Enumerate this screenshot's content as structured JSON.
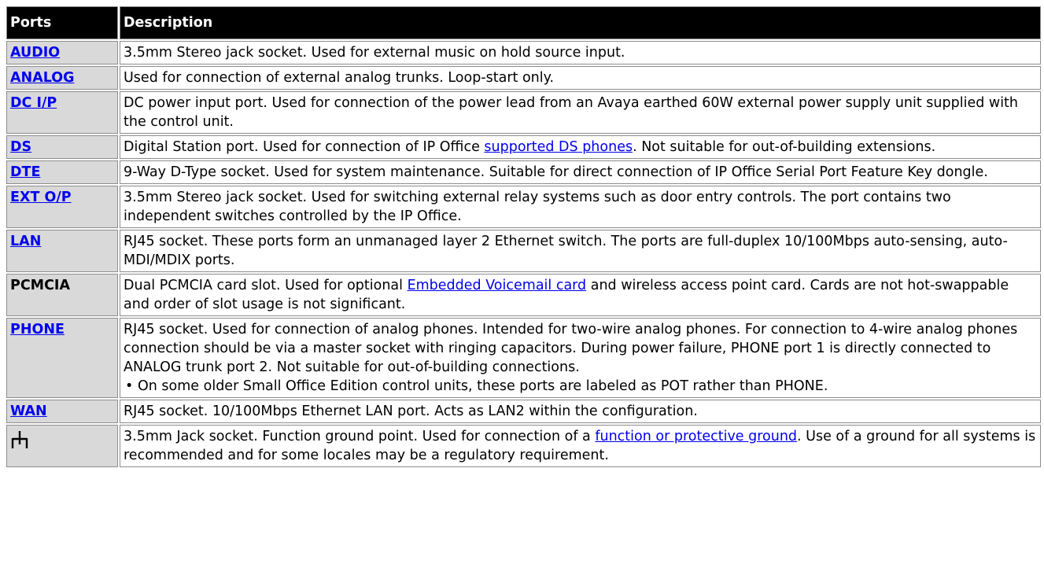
{
  "table": {
    "headers": {
      "ports": "Ports",
      "description": "Description"
    },
    "rows": [
      {
        "port": "AUDIO",
        "segments": [
          "3.5mm Stereo jack socket. Used for external music on hold source input."
        ]
      },
      {
        "port": "ANALOG",
        "segments": [
          "Used for connection of external analog trunks. Loop-start only."
        ]
      },
      {
        "port": "DC I/P",
        "segments": [
          "DC power input port. Used for connection of the power lead from an Avaya earthed 60W external power supply unit supplied with the control unit."
        ]
      },
      {
        "port": "DS",
        "segments": [
          "Digital Station port. Used for connection of IP Office ",
          "supported DS phones",
          ". Not suitable for out-of-building extensions."
        ]
      },
      {
        "port": "DTE",
        "segments": [
          "9-Way D-Type socket. Used for system maintenance. Suitable for direct connection of IP Office Serial Port Feature Key dongle."
        ]
      },
      {
        "port": "EXT O/P",
        "segments": [
          "3.5mm Stereo jack socket. Used for switching external relay systems such as door entry controls. The port contains two independent switches controlled by the IP Office."
        ]
      },
      {
        "port": "LAN",
        "segments": [
          "RJ45 socket. These ports form an unmanaged layer 2 Ethernet switch. The ports are full-duplex 10/100Mbps auto-sensing, auto-MDI/MDIX ports."
        ]
      },
      {
        "port": "PCMCIA",
        "segments": [
          "Dual PCMCIA card slot. Used for optional ",
          "Embedded Voicemail card",
          " and wireless access point card. Cards are not hot-swappable and order of slot usage is not significant."
        ]
      },
      {
        "port": "PHONE",
        "segments": [
          "RJ45 socket. Used for connection of analog phones. Intended for two-wire analog phones. For connection to 4-wire analog phones connection should be via a master socket with ringing capacitors. During power failure, PHONE port 1 is directly connected to ANALOG trunk port 2. Not suitable for out-of-building connections."
        ],
        "note": "On some older Small Office Edition control units, these ports are labeled as POT rather than PHONE."
      },
      {
        "port": "WAN",
        "segments": [
          "RJ45 socket. 10/100Mbps Ethernet LAN port. Acts as LAN2 within the configuration."
        ]
      },
      {
        "port_icon": "functional-ground-icon",
        "segments": [
          "3.5mm Jack socket. Function ground point. Used for connection of a ",
          "function or protective ground",
          ". Use of a ground for all systems is recommended and for some locales may be a regulatory requirement."
        ]
      }
    ]
  },
  "colors": {
    "header_bg": "#000000",
    "port_cell_bg": "#d9d9d9",
    "link": "#0000ee",
    "border": "#8c8c8c"
  }
}
